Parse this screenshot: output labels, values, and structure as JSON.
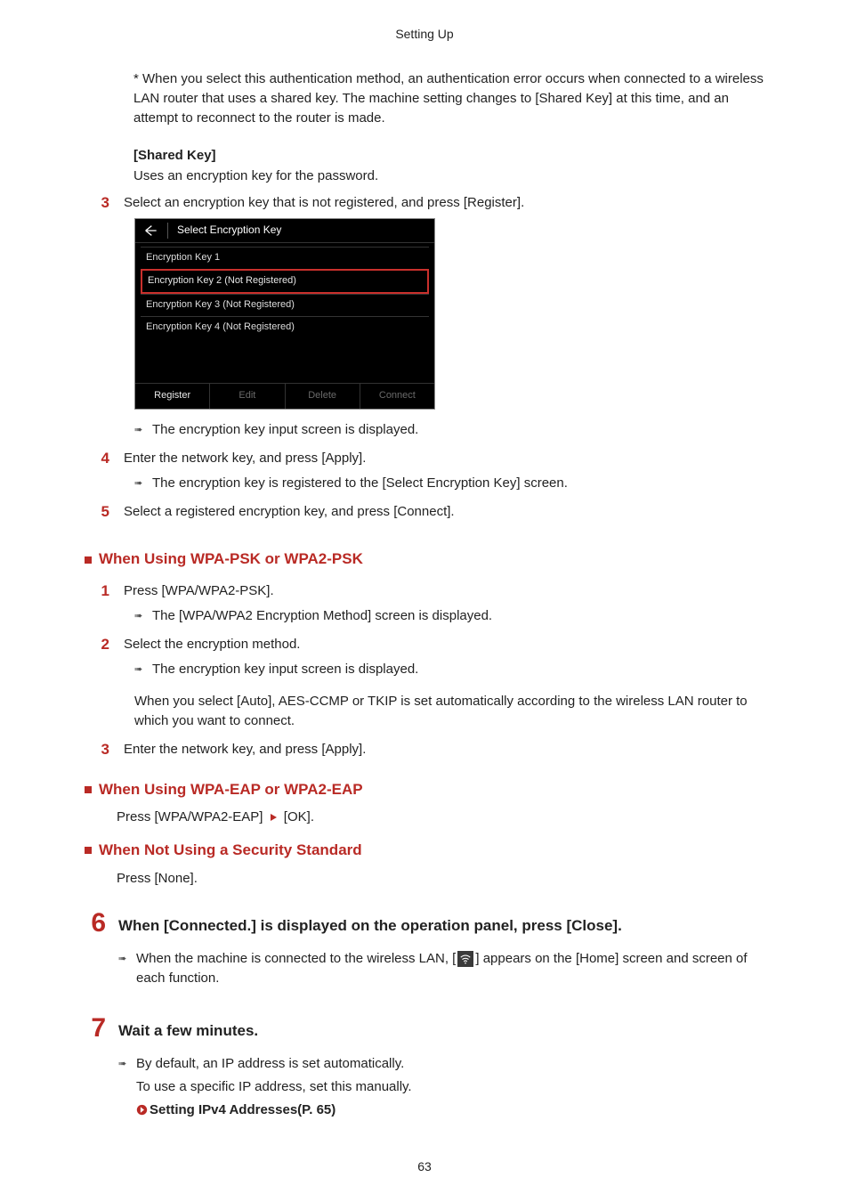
{
  "header": {
    "title": "Setting Up"
  },
  "intro_note": "* When you select this authentication method, an authentication error occurs when connected to a wireless LAN router that uses a shared key. The machine setting changes to [Shared Key] at this time, and an attempt to reconnect to the router is made.",
  "shared_key": {
    "label": "[Shared Key]",
    "text": "Uses an encryption key for the password."
  },
  "step3": {
    "num": "3",
    "text": "Select an encryption key that is not registered, and press [Register].",
    "result": "The encryption key input screen is displayed."
  },
  "shot": {
    "title": "Select Encryption Key",
    "rows": [
      "Encryption Key 1",
      "Encryption Key 2 (Not Registered)",
      "Encryption Key 3 (Not Registered)",
      "Encryption Key 4 (Not Registered)"
    ],
    "buttons": [
      "Register",
      "Edit",
      "Delete",
      "Connect"
    ]
  },
  "step4": {
    "num": "4",
    "text": "Enter the network key, and press [Apply].",
    "result": "The encryption key is registered to the [Select Encryption Key] screen."
  },
  "step5": {
    "num": "5",
    "text": "Select a registered encryption key, and press [Connect]."
  },
  "wpa_psk": {
    "heading": "When Using WPA-PSK or WPA2-PSK",
    "s1": {
      "num": "1",
      "text": "Press [WPA/WPA2-PSK].",
      "result": "The [WPA/WPA2 Encryption Method] screen is displayed."
    },
    "s2": {
      "num": "2",
      "text": "Select the encryption method.",
      "result": "The encryption key input screen is displayed.",
      "note": "When you select [Auto], AES-CCMP or TKIP is set automatically according to the wireless LAN router to which you want to connect."
    },
    "s3": {
      "num": "3",
      "text": "Enter the network key, and press [Apply]."
    }
  },
  "wpa_eap": {
    "heading": "When Using WPA-EAP or WPA2-EAP",
    "pre": "Press [WPA/WPA2-EAP] ",
    "post": " [OK]."
  },
  "no_sec": {
    "heading": "When Not Using a Security Standard",
    "text": "Press [None]."
  },
  "big6": {
    "num": "6",
    "text": "When [Connected.] is displayed on the operation panel, press [Close].",
    "result_pre": "When the machine is connected to the wireless LAN, [",
    "result_post": "] appears on the [Home] screen and screen of each function."
  },
  "big7": {
    "num": "7",
    "text": "Wait a few minutes.",
    "result": "By default, an IP address is set automatically.",
    "note": "To use a specific IP address, set this manually.",
    "link": "Setting IPv4 Addresses(P. 65)"
  },
  "page_num": "63"
}
